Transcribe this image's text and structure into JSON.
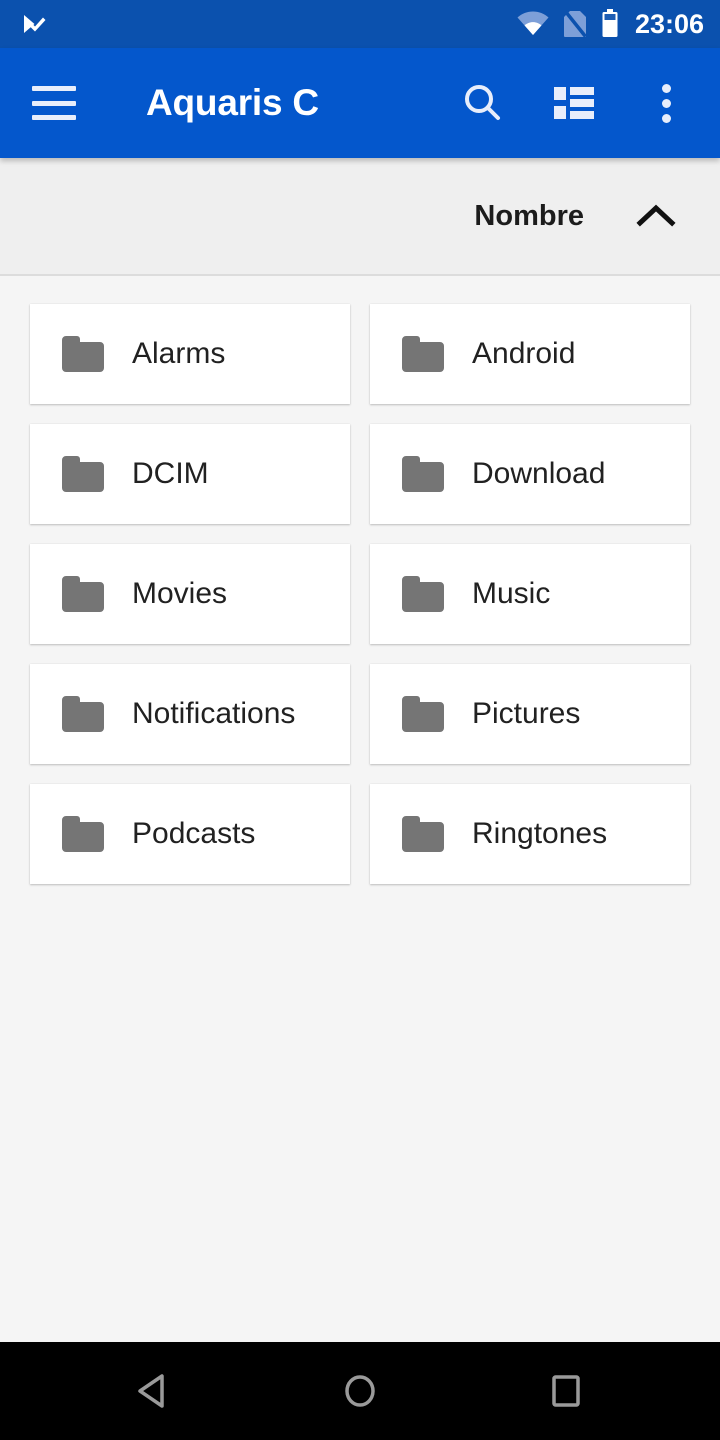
{
  "status_bar": {
    "time": "23:06",
    "notification_icon": "app-notification-icon",
    "wifi_icon": "wifi-icon",
    "sim_icon": "no-sim-card-icon",
    "battery_icon": "battery-icon",
    "background_color": "#0b51ae"
  },
  "toolbar": {
    "title": "Aquaris C",
    "menu_icon": "hamburger-menu-icon",
    "search_icon": "search-icon",
    "view_mode_icon": "list-view-icon",
    "overflow_icon": "overflow-menu-icon",
    "background_color": "#0457cc"
  },
  "sort_bar": {
    "label": "Nombre",
    "direction_icon": "chevron-up-icon",
    "direction": "ascending",
    "background_color": "#efefef"
  },
  "content": {
    "background_color": "#f5f5f5",
    "item_icon": "folder-icon",
    "items": [
      {
        "name": "Alarms"
      },
      {
        "name": "Android"
      },
      {
        "name": "DCIM"
      },
      {
        "name": "Download"
      },
      {
        "name": "Movies"
      },
      {
        "name": "Music"
      },
      {
        "name": "Notifications"
      },
      {
        "name": "Pictures"
      },
      {
        "name": "Podcasts"
      },
      {
        "name": "Ringtones"
      }
    ]
  },
  "nav_bar": {
    "background_color": "#000000",
    "back_icon": "back-triangle-icon",
    "home_icon": "home-circle-icon",
    "recents_icon": "recents-square-icon"
  }
}
